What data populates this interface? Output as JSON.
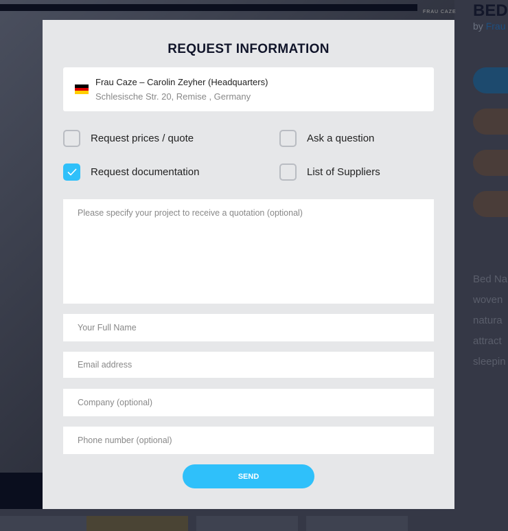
{
  "background": {
    "brand": "FRAU CAZE",
    "product_title": "BED",
    "by_label": "by",
    "by_link": "Frau",
    "description": "Bed Na\nwoven\nnatura\nattract\nsleepin"
  },
  "modal": {
    "title": "REQUEST INFORMATION",
    "supplier": {
      "name": "Frau Caze – Carolin Zeyher (Headquarters)",
      "address": "Schlesische Str. 20, Remise , Germany",
      "flag": "germany-flag"
    },
    "options": [
      {
        "label": "Request prices / quote",
        "checked": false
      },
      {
        "label": "Ask a question",
        "checked": false
      },
      {
        "label": "Request documentation",
        "checked": true
      },
      {
        "label": "List of Suppliers",
        "checked": false
      }
    ],
    "project_placeholder": "Please specify your project to receive a quotation (optional)",
    "name_placeholder": "Your Full Name",
    "email_placeholder": "Email address",
    "company_placeholder": "Company (optional)",
    "phone_placeholder": "Phone number (optional)",
    "send_label": "SEND"
  },
  "colors": {
    "accent": "#2fc0fa",
    "modal_bg": "#e6e7e9",
    "overlay": "#353846"
  }
}
